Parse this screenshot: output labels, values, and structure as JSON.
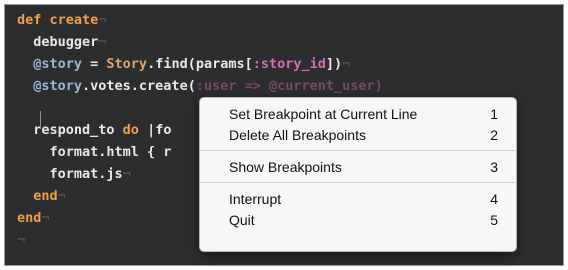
{
  "code": {
    "lines": [
      [
        {
          "t": "def ",
          "c": "kw"
        },
        {
          "t": "create",
          "c": "kw"
        },
        {
          "t": "¬",
          "c": "eol"
        }
      ],
      [
        {
          "t": "  debugger",
          "c": "plain"
        },
        {
          "t": "¬",
          "c": "eol"
        }
      ],
      [
        {
          "t": "  @story",
          "c": "ivar"
        },
        {
          "t": " = ",
          "c": "plain"
        },
        {
          "t": "Story",
          "c": "cls"
        },
        {
          "t": ".find(params[",
          "c": "plain"
        },
        {
          "t": ":story_id",
          "c": "sym"
        },
        {
          "t": "])",
          "c": "plain"
        },
        {
          "t": "¬",
          "c": "eol"
        }
      ],
      [
        {
          "t": "  @story",
          "c": "ivar"
        },
        {
          "t": ".votes.create(",
          "c": "plain"
        },
        {
          "t": ":user => @current_user)",
          "c": "sym"
        }
      ],
      [
        {
          "t": "  ",
          "c": "plain"
        }
      ],
      [
        {
          "t": "  respond_to ",
          "c": "plain"
        },
        {
          "t": "do",
          "c": "kw"
        },
        {
          "t": " |fo",
          "c": "plain"
        }
      ],
      [
        {
          "t": "    format.html { r",
          "c": "plain"
        }
      ],
      [
        {
          "t": "    format.js",
          "c": "plain"
        },
        {
          "t": "¬",
          "c": "eol"
        }
      ],
      [
        {
          "t": "  end",
          "c": "kw"
        },
        {
          "t": "¬",
          "c": "eol"
        }
      ],
      [
        {
          "t": "end",
          "c": "kw"
        },
        {
          "t": "¬",
          "c": "eol"
        }
      ],
      [
        {
          "t": "¬",
          "c": "eol"
        }
      ]
    ]
  },
  "menu": {
    "groups": [
      [
        {
          "label": "Set Breakpoint at Current Line",
          "key": "1"
        },
        {
          "label": "Delete All Breakpoints",
          "key": "2"
        }
      ],
      [
        {
          "label": "Show Breakpoints",
          "key": "3"
        }
      ],
      [
        {
          "label": "Interrupt",
          "key": "4"
        },
        {
          "label": "Quit",
          "key": "5"
        }
      ]
    ]
  }
}
